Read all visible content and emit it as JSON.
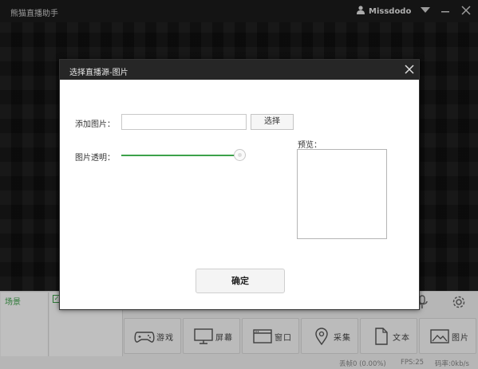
{
  "app": {
    "title": "熊猫直播助手",
    "user_name": "Missdodo"
  },
  "scenes": {
    "label": "场景"
  },
  "toolbar": {
    "buttons": [
      {
        "label": "游戏",
        "icon": "gamepad-icon"
      },
      {
        "label": "屏幕",
        "icon": "monitor-icon"
      },
      {
        "label": "窗口",
        "icon": "window-icon"
      },
      {
        "label": "采集",
        "icon": "location-pin-icon"
      },
      {
        "label": "文本",
        "icon": "document-icon"
      },
      {
        "label": "图片",
        "icon": "image-icon"
      }
    ]
  },
  "status": {
    "dropped": "丢帧0 (0.00%)",
    "fps": "FPS:25",
    "rate": "码率:0kb/s"
  },
  "dialog": {
    "title": "选择直播源-图片",
    "add_image_label": "添加图片：",
    "path_value": "",
    "path_placeholder": "",
    "choose_label": "选择",
    "opacity_label": "图片透明：",
    "opacity_value": 1.0,
    "preview_label": "预览：",
    "ok_label": "确定"
  },
  "colors": {
    "accent": "#3ca24a",
    "titlebar": "#1b1b1b",
    "dialog_header": "#262626"
  }
}
